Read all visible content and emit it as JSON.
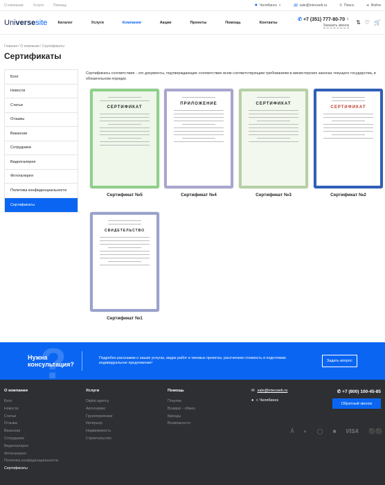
{
  "topbar": {
    "links": [
      "О компании",
      "Услуги",
      "Помощь"
    ],
    "city": "Челябинск",
    "email": "sale@intecweb.ru",
    "search": "Поиск",
    "login": "Войти"
  },
  "header": {
    "logo_a": "Uni",
    "logo_b": "verse",
    "logo_c": "site",
    "nav": [
      "Каталог",
      "Услуги",
      "Компания",
      "Акции",
      "Проекты",
      "Помощь",
      "Контакты"
    ],
    "active_nav": "Компания",
    "phone": "+7 (351) 777-80-70",
    "callback": "Заказать звонок"
  },
  "breadcrumb": "Главная  /  О компании  /  Сертификаты",
  "page_title": "Сертификаты",
  "sidebar": {
    "items": [
      "Блог",
      "Новости",
      "Статьи",
      "Отзывы",
      "Вакансии",
      "Сотрудники",
      "Видеогалерея",
      "Фотогалерея",
      "Политика конфиденциальности",
      "Сертификаты"
    ],
    "active": "Сертификаты"
  },
  "intro": "Сертификаты соответствия - это документы, подтверждающие соответствие всем соответствующим требованиям в министерских законах текущего государства, в обязательном порядке.",
  "certs": [
    {
      "caption": "Сертификат №5",
      "title": "СЕРТИФИКАТ",
      "frame": "#8fd08a"
    },
    {
      "caption": "Сертификат №4",
      "title": "ПРИЛОЖЕНИЕ",
      "frame": "#a8a6cf"
    },
    {
      "caption": "Сертификат №3",
      "title": "СЕРТИФИКАТ",
      "frame": "#b7d0a6"
    },
    {
      "caption": "Сертификат №2",
      "title": "СЕРТИФИКАТ",
      "frame": "#2f5fb8"
    },
    {
      "caption": "Сертификат №1",
      "title": "СВИДЕТЕЛЬСТВО",
      "frame": "#9aa2cc"
    }
  ],
  "cta": {
    "heading": "Нужна консультация?",
    "text": "Подробно расскажем о наших услугах, видах работ и типовых проектах, рассчитаем стоимость и подготовим индивидуальное предложение!",
    "button": "Задать вопрос"
  },
  "footer": {
    "company": {
      "title": "О компании",
      "items": [
        "Блог",
        "Новости",
        "Статьи",
        "Отзывы",
        "Вакансии",
        "Сотрудники",
        "Видеогалерея",
        "Фотогалерея",
        "Политика конфиденциальности",
        "Сертификаты"
      ]
    },
    "services": {
      "title": "Услуги",
      "items": [
        "Digital agency",
        "Автосервис",
        "Грузоперевозки",
        "Интерьер",
        "Недвижимость",
        "Строительство"
      ]
    },
    "help": {
      "title": "Помощь",
      "items": [
        "Покупки",
        "Возврат - обмен",
        "Бренды",
        "Возможности"
      ]
    },
    "email": "sale@intecweb.ru",
    "city": "г. Челябинск",
    "phone": "+7 (800) 100-45-85",
    "callback": "Обратный звонок",
    "pay": "VISA"
  },
  "colors": {
    "accent": "#0a66f2",
    "footer_bg": "#2d2f33"
  }
}
